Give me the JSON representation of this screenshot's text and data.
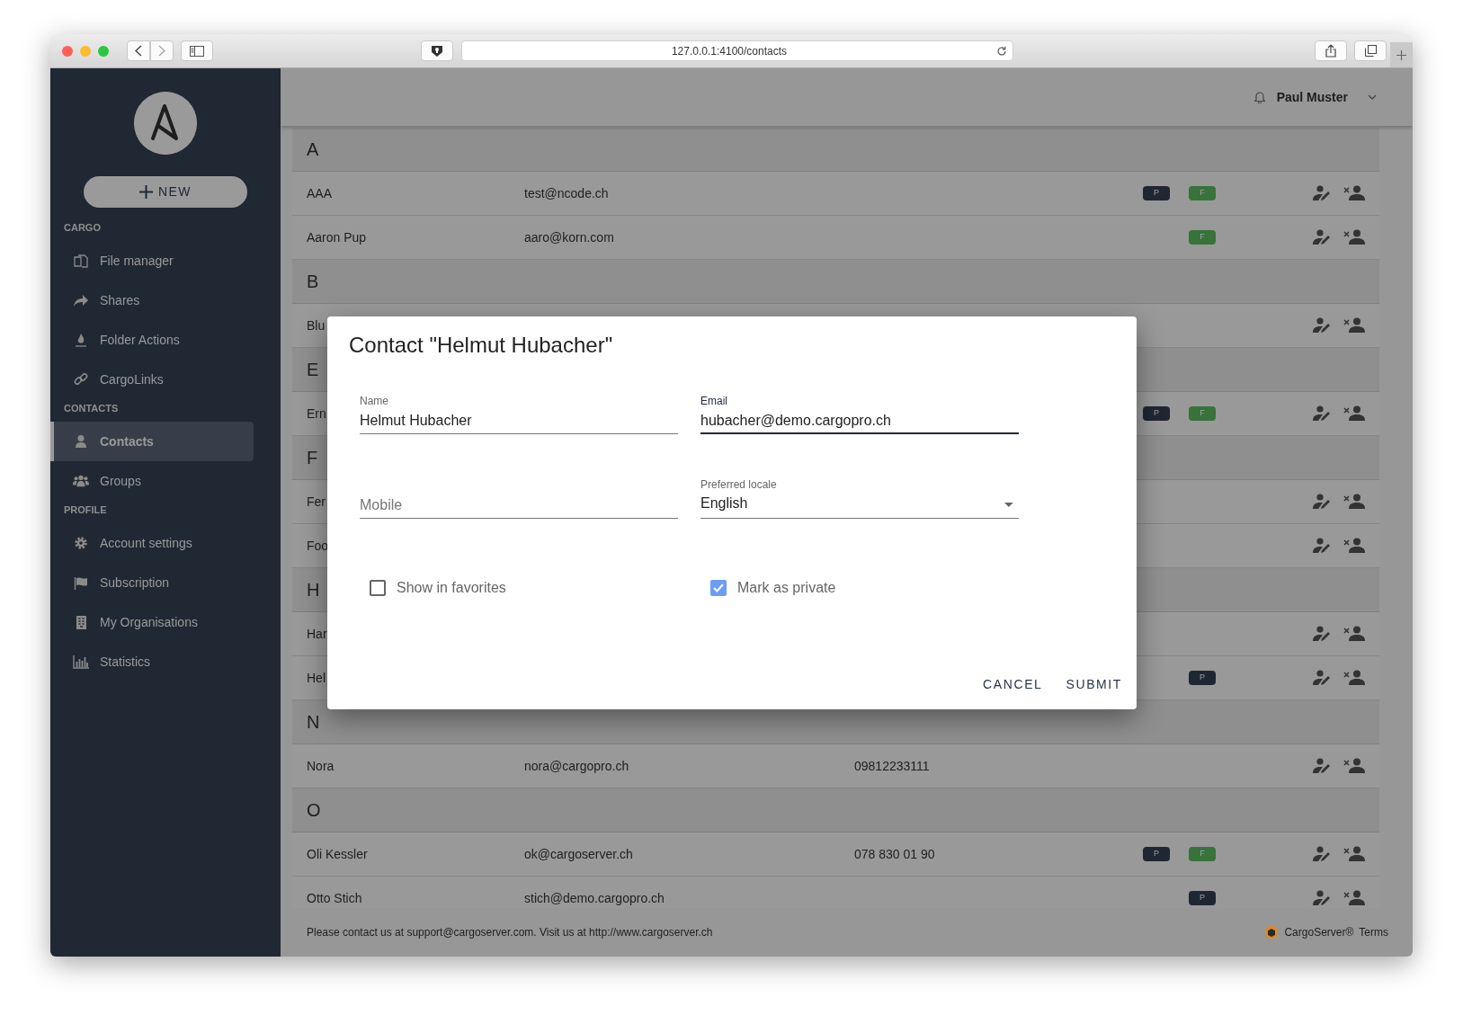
{
  "browser": {
    "url": "127.0.0.1:4100/contacts"
  },
  "sidebar": {
    "new_button": "NEW",
    "sections": [
      {
        "title": "CARGO",
        "items": [
          {
            "label": "File manager",
            "selected": false
          },
          {
            "label": "Shares",
            "selected": false
          },
          {
            "label": "Folder Actions",
            "selected": false
          },
          {
            "label": "CargoLinks",
            "selected": false
          }
        ]
      },
      {
        "title": "CONTACTS",
        "items": [
          {
            "label": "Contacts",
            "selected": true
          },
          {
            "label": "Groups",
            "selected": false
          }
        ]
      },
      {
        "title": "PROFILE",
        "items": [
          {
            "label": "Account settings",
            "selected": false
          },
          {
            "label": "Subscription",
            "selected": false
          },
          {
            "label": "My Organisations",
            "selected": false
          },
          {
            "label": "Statistics",
            "selected": false
          }
        ]
      }
    ]
  },
  "header": {
    "user": "Paul Muster"
  },
  "contacts": {
    "groups": [
      {
        "letter": "A",
        "rows": [
          {
            "name": "AAA",
            "email": "test@ncode.ch",
            "badges": [
              {
                "label": "P",
                "color": "#1f2733"
              },
              {
                "label": "F",
                "color": "#37733a"
              }
            ]
          },
          {
            "name": "Aaron Pup",
            "email": "aaro@korn.com",
            "badges": [
              {
                "label": "F",
                "color": "#37733a"
              }
            ]
          }
        ]
      },
      {
        "letter": "B",
        "rows": [
          {
            "name": "Blu"
          }
        ]
      },
      {
        "letter": "E",
        "rows": [
          {
            "name": "Ern",
            "badges": [
              {
                "label": "P",
                "color": "#1f2733"
              },
              {
                "label": "F",
                "color": "#37733a"
              }
            ]
          }
        ]
      },
      {
        "letter": "F",
        "rows": [
          {
            "name": "Fer"
          },
          {
            "name": "Foo"
          }
        ]
      },
      {
        "letter": "H",
        "rows": [
          {
            "name": "Har"
          },
          {
            "name": "Hel",
            "badges": [
              {
                "label": "P",
                "color": "#1f2733"
              }
            ]
          }
        ]
      },
      {
        "letter": "N",
        "rows": [
          {
            "name": "Nora",
            "email": "nora@cargopro.ch",
            "phone": "09812233111"
          }
        ]
      },
      {
        "letter": "O",
        "rows": [
          {
            "name": "Oli Kessler",
            "email": "ok@cargoserver.ch",
            "phone": "078 830 01 90",
            "badges": [
              {
                "label": "P",
                "color": "#1f2733"
              },
              {
                "label": "F",
                "color": "#37733a"
              }
            ]
          },
          {
            "name": "Otto Stich",
            "email": "stich@demo.cargopro.ch",
            "badges": [
              {
                "label": "P",
                "color": "#1f2733"
              }
            ]
          }
        ]
      }
    ]
  },
  "footer": {
    "notice": "Please contact us at support@cargoserver.com. Visit us at http://www.cargoserver.ch",
    "brand": "CargoServer®",
    "terms": "Terms"
  },
  "dialog": {
    "title": "Contact \"Helmut Hubacher\"",
    "field_rows": [
      {
        "fields": [
          {
            "kind": "text",
            "label": "Name",
            "value": "Helmut Hubacher",
            "focused": false
          },
          {
            "kind": "text",
            "label": "Email",
            "value": "hubacher@demo.cargopro.ch",
            "focused": true
          }
        ]
      },
      {
        "fields": [
          {
            "kind": "text",
            "placeholder": "Mobile",
            "focused": false
          },
          {
            "kind": "select",
            "label": "Preferred locale",
            "value": "English",
            "focused": false
          }
        ]
      }
    ],
    "checkboxes": [
      {
        "label": "Show in favorites",
        "checked": false
      },
      {
        "label": "Mark as private",
        "checked": true
      }
    ],
    "buttons": [
      "CANCEL",
      "SUBMIT"
    ]
  }
}
